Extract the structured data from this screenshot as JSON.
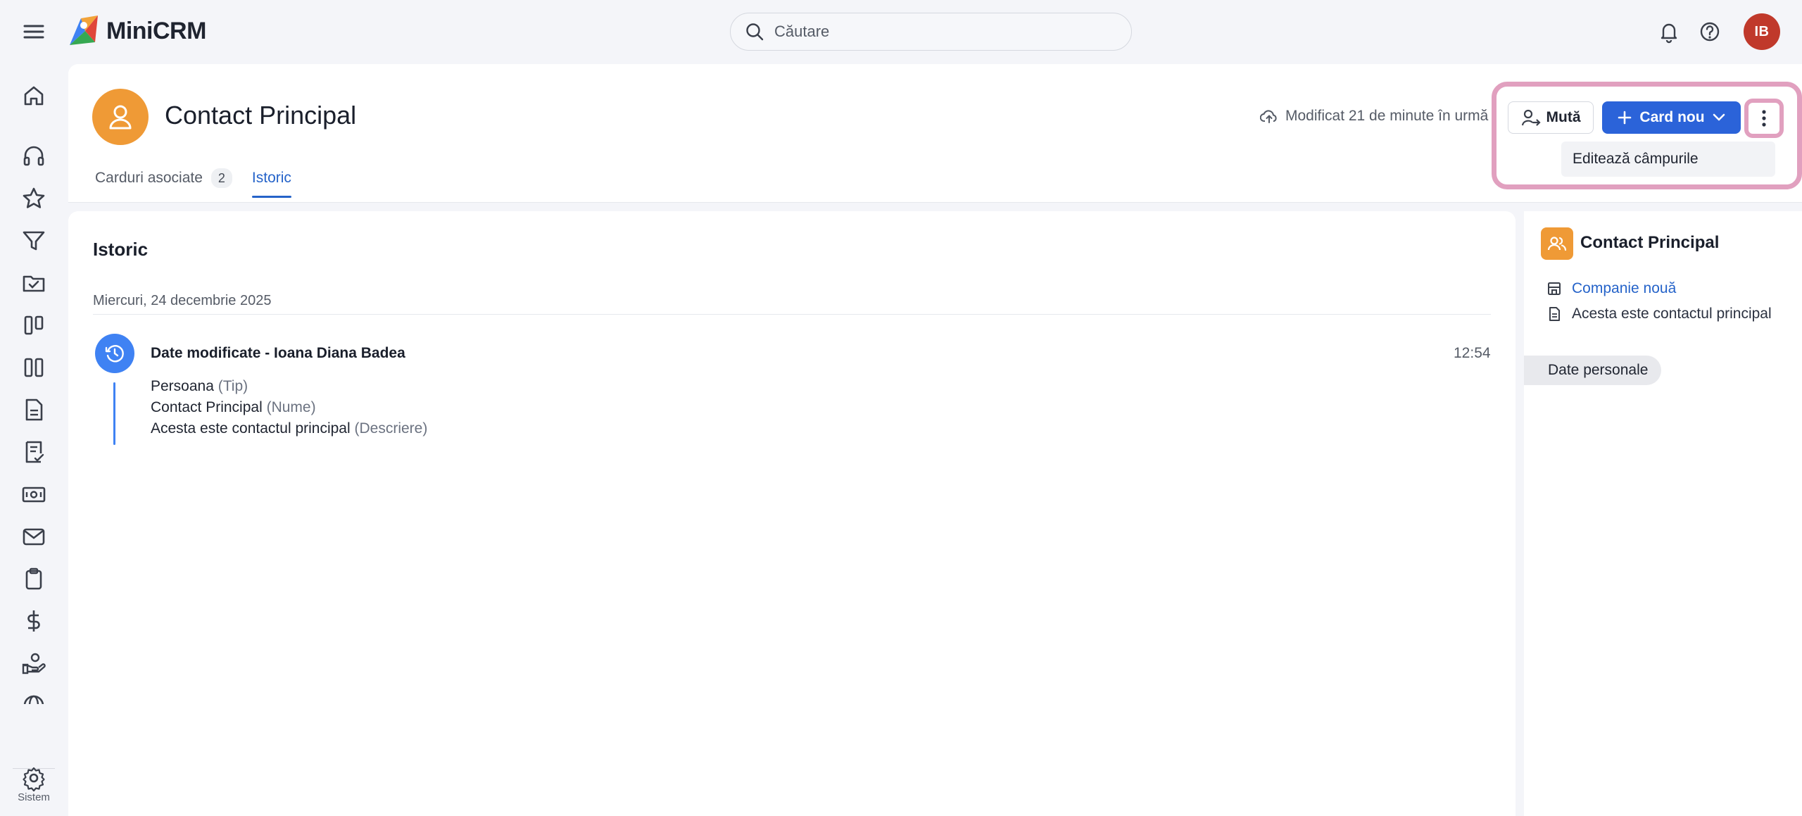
{
  "app": {
    "name": "MiniCRM"
  },
  "search": {
    "placeholder": "Căutare"
  },
  "user": {
    "initials": "IB"
  },
  "sidebar": {
    "section_label": "Sistem"
  },
  "header": {
    "title": "Contact Principal",
    "modified": "Modificat 21 de minute în urmă",
    "tabs": [
      {
        "label": "Carduri asociate",
        "count": "2"
      },
      {
        "label": "Istoric"
      }
    ],
    "actions": {
      "move_label": "Mută",
      "new_card_label": "Card nou",
      "menu_item": "Editează câmpurile"
    }
  },
  "history": {
    "title": "Istoric",
    "date": "Miercuri, 24 decembrie 2025",
    "event": {
      "title": "Date modificate - Ioana Diana Badea",
      "time": "12:54",
      "changes": [
        {
          "value": "Persoana",
          "field": "(Tip)"
        },
        {
          "value": "Contact Principal",
          "field": "(Nume)"
        },
        {
          "value": "Acesta este contactul principal",
          "field": "(Descriere)"
        }
      ]
    }
  },
  "side_panel": {
    "title": "Contact Principal",
    "company_link": "Companie nouă",
    "description": "Acesta este contactul principal",
    "section_tag": "Date personale"
  },
  "colors": {
    "accent": "#2b63d9",
    "entity_orange": "#ef9a36",
    "avatar_red": "#c0392b",
    "timeline_blue": "#3f82f3",
    "highlight_pink": "#e1a0bf"
  }
}
